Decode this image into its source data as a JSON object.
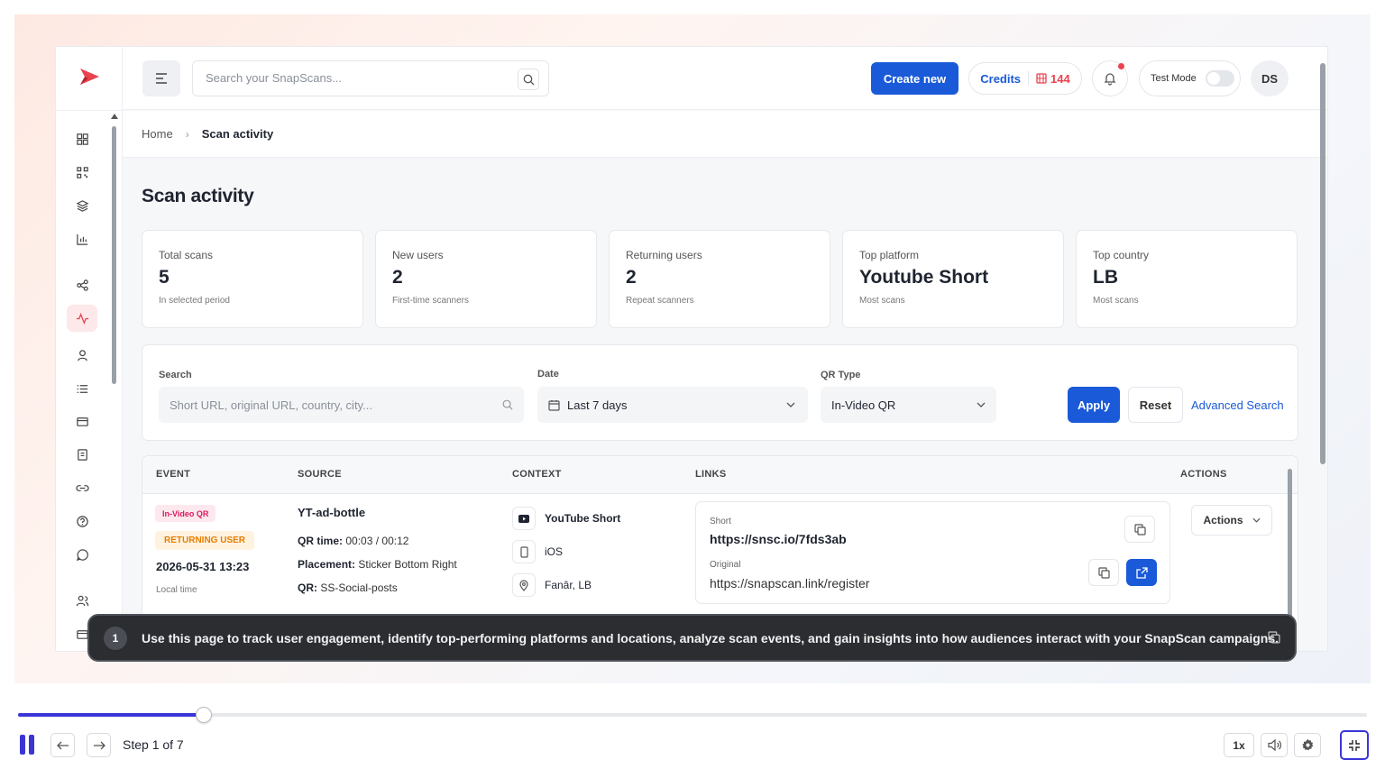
{
  "app": {
    "search_placeholder": "Search your SnapScans...",
    "create_label": "Create new",
    "credits_label": "Credits",
    "credits_count": "144",
    "test_mode_label": "Test Mode",
    "avatar_initials": "DS"
  },
  "breadcrumb": {
    "home": "Home",
    "current": "Scan activity"
  },
  "page_title": "Scan activity",
  "stats": [
    {
      "title": "Total scans",
      "value": "5",
      "sub": "In selected period"
    },
    {
      "title": "New users",
      "value": "2",
      "sub": "First-time scanners"
    },
    {
      "title": "Returning users",
      "value": "2",
      "sub": "Repeat scanners"
    },
    {
      "title": "Top platform",
      "value": "Youtube Short",
      "sub": "Most scans"
    },
    {
      "title": "Top country",
      "value": "LB",
      "sub": "Most scans"
    }
  ],
  "filters": {
    "search_label": "Search",
    "search_placeholder": "Short URL, original URL, country, city...",
    "date_label": "Date",
    "date_value": "Last 7 days",
    "qr_label": "QR Type",
    "qr_value": "In-Video QR",
    "apply": "Apply",
    "reset": "Reset",
    "advanced": "Advanced Search"
  },
  "table": {
    "headers": [
      "EVENT",
      "SOURCE",
      "CONTEXT",
      "LINKS",
      "ACTIONS"
    ],
    "rows": [
      {
        "qr_badge": "In-Video QR",
        "user_badge": "RETURNING USER",
        "time": "2026-05-31 13:23",
        "time_note": "Local time",
        "source_name": "YT-ad-bottle",
        "qr_time_label": "QR time:",
        "qr_time": "00:03 / 00:12",
        "placement_label": "Placement:",
        "placement": "Sticker Bottom Right",
        "qr_label": "QR:",
        "qr": "SS-Social-posts",
        "platform": "YouTube Short",
        "os": "iOS",
        "location": "Fanâr, LB",
        "short_label": "Short",
        "short_url": "https://snsc.io/7fds3ab",
        "original_label": "Original",
        "original_url": "https://snapscan.link/register",
        "actions_label": "Actions"
      }
    ]
  },
  "tooltip": {
    "step_number": "1",
    "message": "Use this page to track user engagement, identify top-performing platforms and locations, analyze scan events, and gain insights into how audiences interact with your SnapScan campaigns."
  },
  "player": {
    "progress": 0.138,
    "step_label": "Step 1 of 7",
    "speed": "1x",
    "accent": "#3b35d8"
  },
  "colors": {
    "primary": "#1a5ad8",
    "brand": "#e8434f"
  }
}
